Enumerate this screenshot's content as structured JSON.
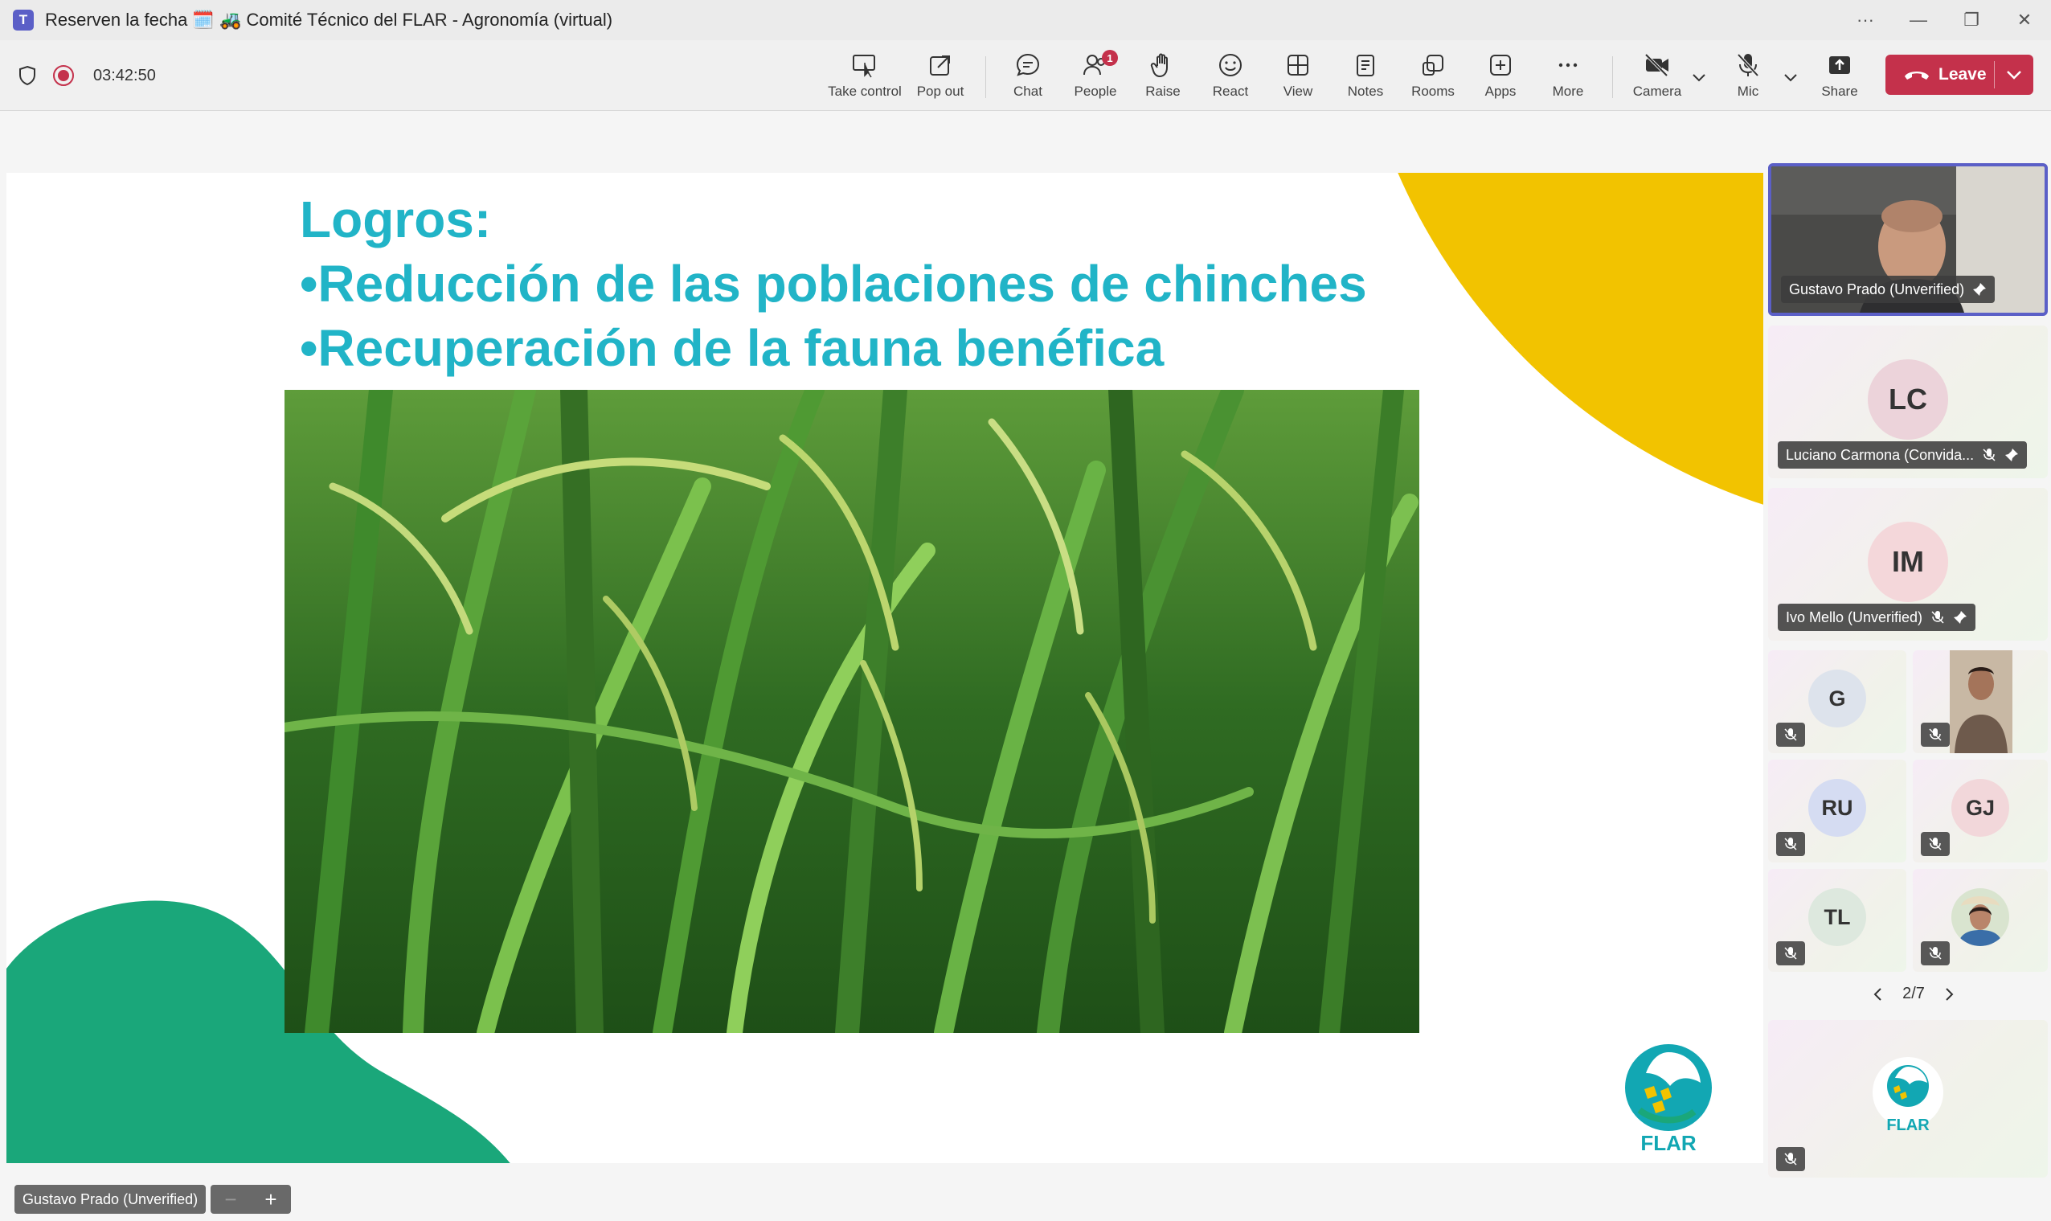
{
  "window": {
    "title": "Reserven la fecha 🗓️ 🚜 Comité Técnico del FLAR - Agronomía (virtual)",
    "app_icon": "teams-icon"
  },
  "toolbar": {
    "timer": "03:42:50",
    "buttons": {
      "take_control": "Take control",
      "pop_out": "Pop out",
      "chat": "Chat",
      "people": "People",
      "people_badge": "1",
      "raise": "Raise",
      "react": "React",
      "view": "View",
      "notes": "Notes",
      "rooms": "Rooms",
      "apps": "Apps",
      "more": "More",
      "camera": "Camera",
      "mic": "Mic",
      "share": "Share"
    },
    "leave_label": "Leave",
    "leave_color": "#c4314b"
  },
  "slide": {
    "title": "Logros:",
    "bullets": [
      "•Reducción de las poblaciones de chinches",
      "•Recuperación de la fauna benéfica"
    ],
    "logo_text": "FLAR",
    "accent_text_color": "#21b4c7",
    "yellow_shape": "#f2c300",
    "green_shape": "#1aa77a"
  },
  "stage": {
    "presenter_name": "Gustavo Prado (Unverified)",
    "zoom_out": "−",
    "zoom_in": "+"
  },
  "participants": {
    "featured": [
      {
        "name": "Gustavo Prado (Unverified)",
        "video": true
      },
      {
        "name": "Luciano Carmona (Convida...",
        "initials": "LC",
        "color": "#ecd3da"
      },
      {
        "name": "Ivo Mello (Unverified)",
        "initials": "IM",
        "color": "#f4d7da"
      }
    ],
    "grid": [
      {
        "initials": "G",
        "color": "#dde3ec"
      },
      {
        "video": true
      },
      {
        "initials": "RU",
        "color": "#d5dcf2"
      },
      {
        "initials": "GJ",
        "color": "#f2d7da"
      },
      {
        "initials": "TL",
        "color": "#dde8de"
      },
      {
        "video": true
      }
    ],
    "pager": "2/7",
    "bottom_logo_text": "FLAR"
  }
}
